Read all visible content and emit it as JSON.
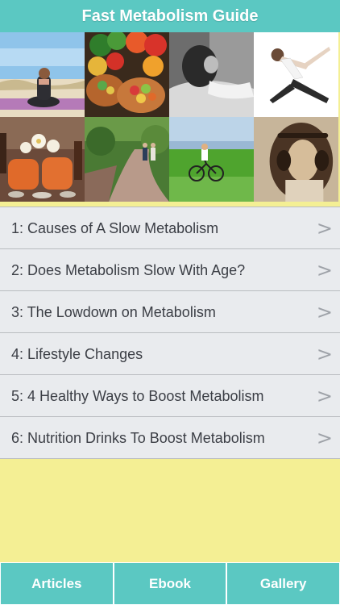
{
  "header": {
    "title": "Fast Metabolism Guide"
  },
  "gallery": {
    "images": [
      {
        "name": "woman-meditating-beach-image"
      },
      {
        "name": "vegetables-fruit-bowls-image"
      },
      {
        "name": "woman-resting-black-white-image"
      },
      {
        "name": "woman-stretching-yoga-image"
      },
      {
        "name": "spa-towels-flowers-image"
      },
      {
        "name": "couple-walking-garden-path-image"
      },
      {
        "name": "cyclist-field-image"
      },
      {
        "name": "woman-headphones-sepia-image"
      }
    ]
  },
  "articles": [
    {
      "label": "1: Causes of A Slow Metabolism",
      "chevron": ">"
    },
    {
      "label": "2: Does Metabolism Slow With Age?",
      "chevron": ">"
    },
    {
      "label": "3: The Lowdown on Metabolism",
      "chevron": ">"
    },
    {
      "label": "4: Lifestyle Changes",
      "chevron": ">"
    },
    {
      "label": "5: 4 Healthy Ways to Boost Metabolism",
      "chevron": ">"
    },
    {
      "label": "6: Nutrition Drinks To Boost Metabolism",
      "chevron": ">"
    }
  ],
  "tabs": [
    {
      "label": "Articles"
    },
    {
      "label": "Ebook"
    },
    {
      "label": "Gallery"
    }
  ],
  "colors": {
    "accent": "#5bc8c2",
    "background": "#f4ef94",
    "row_background": "#e9ebee"
  }
}
